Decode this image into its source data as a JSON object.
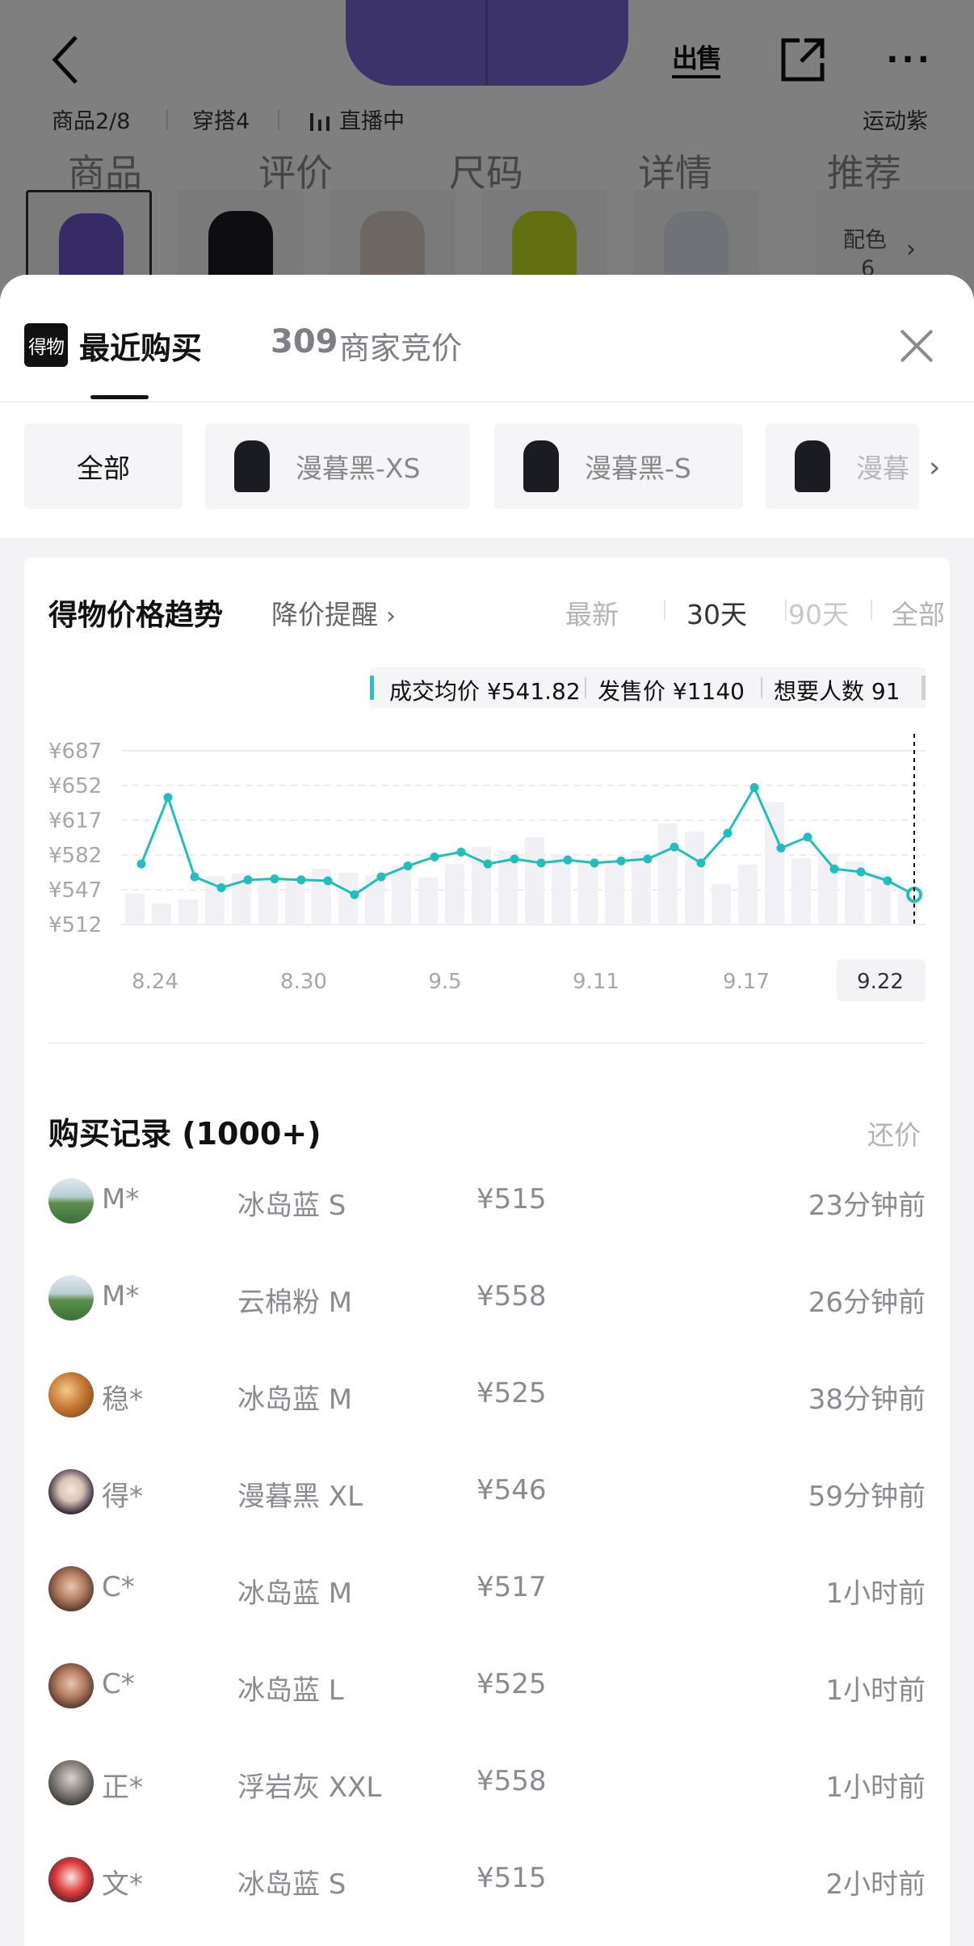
{
  "header": {
    "sell_label": "出售",
    "product_index": "商品2/8",
    "outfits": "穿搭4",
    "live": "直播中",
    "color_name": "运动紫",
    "tabs": [
      "商品",
      "评价",
      "尺码",
      "详情",
      "推荐"
    ],
    "more_colors": "配色",
    "more_colors_count": "6"
  },
  "sheet": {
    "logo_text": "得物",
    "tab_recent": "最近购买",
    "tab_bids_count": "309",
    "tab_bids": "商家竞价",
    "filters": [
      {
        "label": "全部"
      },
      {
        "label": "漫暮黑-XS"
      },
      {
        "label": "漫暮黑-S"
      },
      {
        "label": "漫暮"
      }
    ]
  },
  "trend": {
    "title": "得物价格趋势",
    "alert_label": "降价提醒",
    "range_tabs": [
      "最新",
      "30天",
      "90天",
      "全部"
    ],
    "active_range": "30天",
    "summary": {
      "avg_label": "成交均价 ¥541.82",
      "release_label": "发售价 ¥1140",
      "want_label": "想要人数 91"
    }
  },
  "chart_data": {
    "type": "line",
    "ylim": [
      512,
      687
    ],
    "y_ticks": [
      "¥687",
      "¥652",
      "¥617",
      "¥582",
      "¥547",
      "¥512"
    ],
    "y_tick_values": [
      687,
      652,
      617,
      582,
      547,
      512
    ],
    "x_tick_labels": [
      "8.24",
      "8.30",
      "9.5",
      "9.11",
      "9.17",
      "9.22"
    ],
    "selected_x_label": "9.22",
    "line_color": "#22bdbd",
    "series": [
      {
        "values": [
          573,
          640,
          560,
          549,
          557,
          558,
          557,
          556,
          542,
          560,
          571,
          580,
          585,
          573,
          578,
          574,
          577,
          574,
          576,
          578,
          590,
          574,
          604,
          650,
          589,
          600,
          568,
          565,
          556,
          542
        ]
      }
    ],
    "volume_bars": [
      38,
      26,
      31,
      60,
      63,
      57,
      55,
      69,
      64,
      61,
      73,
      58,
      75,
      96,
      91,
      108,
      87,
      81,
      79,
      91,
      125,
      115,
      50,
      74,
      151,
      82,
      88,
      78,
      63,
      41
    ]
  },
  "records": {
    "title": "购买记录 (1000+)",
    "counter_label": "还价",
    "rows": [
      {
        "name": "M*",
        "sku": "冰岛蓝 S",
        "price": "¥515",
        "time": "23分钟前",
        "avatar": "landscape"
      },
      {
        "name": "M*",
        "sku": "云棉粉 M",
        "price": "¥558",
        "time": "26分钟前",
        "avatar": "landscape"
      },
      {
        "name": "稳*",
        "sku": "冰岛蓝 M",
        "price": "¥525",
        "time": "38分钟前",
        "avatar": "sunset"
      },
      {
        "name": "得*",
        "sku": "漫暮黑 XL",
        "price": "¥546",
        "time": "59分钟前",
        "avatar": "cartoon"
      },
      {
        "name": "C*",
        "sku": "冰岛蓝 M",
        "price": "¥517",
        "time": "1小时前",
        "avatar": "portrait"
      },
      {
        "name": "C*",
        "sku": "冰岛蓝 L",
        "price": "¥525",
        "time": "1小时前",
        "avatar": "portrait"
      },
      {
        "name": "正*",
        "sku": "浮岩灰 XXL",
        "price": "¥558",
        "time": "1小时前",
        "avatar": "dark"
      },
      {
        "name": "文*",
        "sku": "冰岛蓝 S",
        "price": "¥515",
        "time": "2小时前",
        "avatar": "red"
      }
    ]
  }
}
